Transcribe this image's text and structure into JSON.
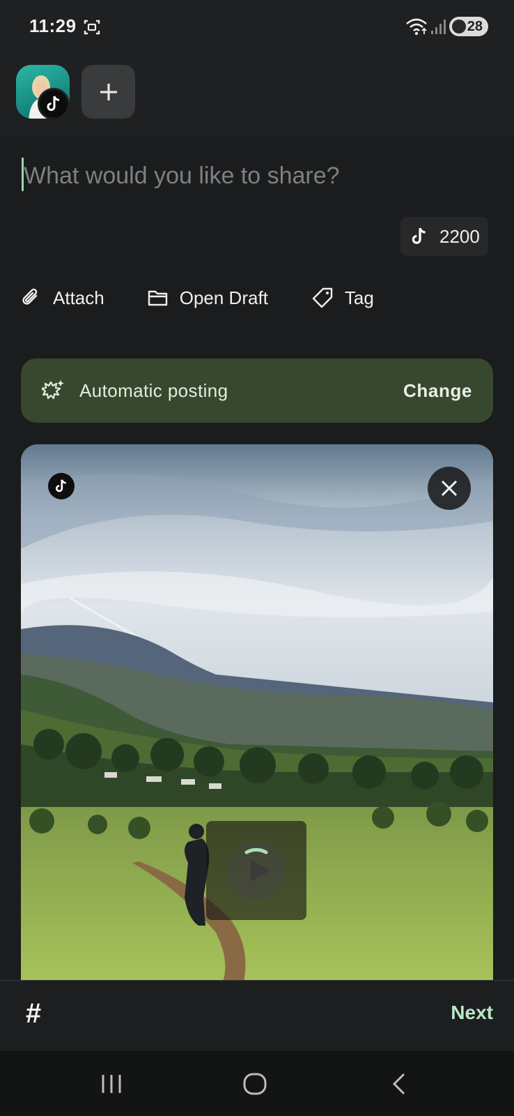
{
  "status_bar": {
    "time": "11:29",
    "battery": "28",
    "icons": [
      "screenshot-icon",
      "wifi-icon",
      "signal-icon",
      "battery-icon"
    ]
  },
  "accounts": {
    "active_platform": "tiktok",
    "add_label": "+"
  },
  "compose": {
    "placeholder": "What would you like to share?",
    "value": "",
    "char_limit": "2200"
  },
  "actions": [
    {
      "label": "Attach",
      "icon": "paperclip-icon"
    },
    {
      "label": "Open Draft",
      "icon": "folder-icon"
    },
    {
      "label": "Tag",
      "icon": "tag-icon"
    }
  ],
  "posting": {
    "label": "Automatic posting",
    "change_label": "Change"
  },
  "toolbar": {
    "hashtag_label": "#",
    "next_label": "Next"
  },
  "colors": {
    "background": "#1b1c1d",
    "posting_card": "#38482f",
    "accent": "#b9e8c4",
    "cursor": "#9bd6b0"
  }
}
